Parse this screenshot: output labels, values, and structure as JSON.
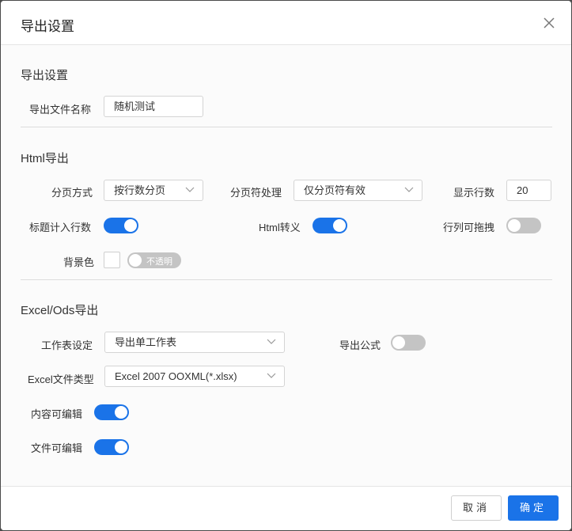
{
  "dialog": {
    "title": "导出设置",
    "close_icon": "close-icon"
  },
  "general": {
    "section_title": "导出设置",
    "filename_label": "导出文件名称",
    "filename_value": "随机测试"
  },
  "html": {
    "section_title": "Html导出",
    "paging_label": "分页方式",
    "paging_value": "按行数分页",
    "pagebreak_label": "分页符处理",
    "pagebreak_value": "仅分页符有效",
    "rows_label": "显示行数",
    "rows_value": "20",
    "title_rows_label": "标题计入行数",
    "title_rows_on": true,
    "html_escape_label": "Html转义",
    "html_escape_on": true,
    "draggable_label": "行列可拖拽",
    "draggable_on": false,
    "bgcolor_label": "背景色",
    "opacity_label": "不透明",
    "opacity_on": false
  },
  "excel": {
    "section_title": "Excel/Ods导出",
    "sheet_label": "工作表设定",
    "sheet_value": "导出单工作表",
    "formula_label": "导出公式",
    "formula_on": false,
    "filetype_label": "Excel文件类型",
    "filetype_value": "Excel 2007 OOXML(*.xlsx)",
    "content_edit_label": "内容可编辑",
    "content_edit_on": true,
    "file_edit_label": "文件可编辑",
    "file_edit_on": true
  },
  "footer": {
    "cancel_label": "取消",
    "ok_label": "确定"
  },
  "colors": {
    "accent": "#1a73e8",
    "toggle_off": "#c4c4c4",
    "border": "#d4d4d4"
  }
}
